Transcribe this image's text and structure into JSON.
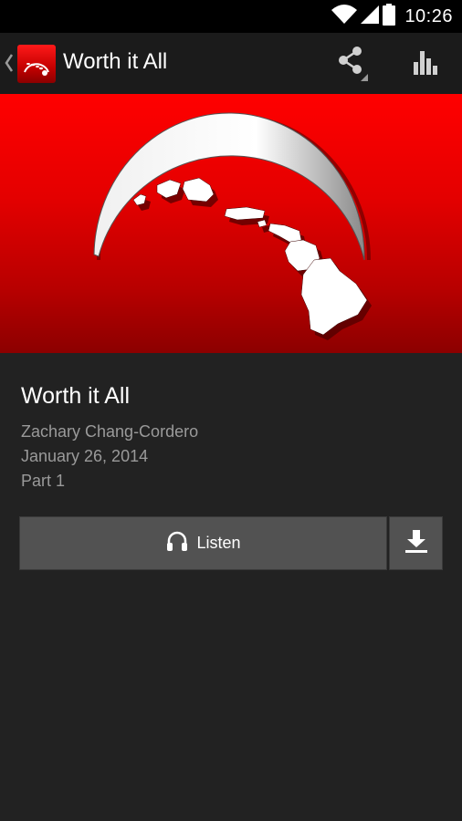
{
  "status_bar": {
    "time": "10:26",
    "icons": [
      "wifi-icon",
      "signal-icon",
      "battery-icon"
    ]
  },
  "action_bar": {
    "title": "Worth it All",
    "icons": [
      "up-caret-icon",
      "app-logo-icon",
      "share-icon",
      "stats-icon"
    ]
  },
  "hero": {
    "image": "hawaiian-islands-logo"
  },
  "episode": {
    "title": "Worth it All",
    "speaker": "Zachary Chang-Cordero",
    "date": "January 26, 2014",
    "part": "Part 1"
  },
  "actions": {
    "listen_label": "Listen",
    "listen_icon": "headphones-icon",
    "download_icon": "download-icon"
  },
  "colors": {
    "background": "#222222",
    "action_bar": "#1b1b1b",
    "accent_red": "#e40000",
    "button": "#525252",
    "secondary_text": "#9a9a9a"
  }
}
